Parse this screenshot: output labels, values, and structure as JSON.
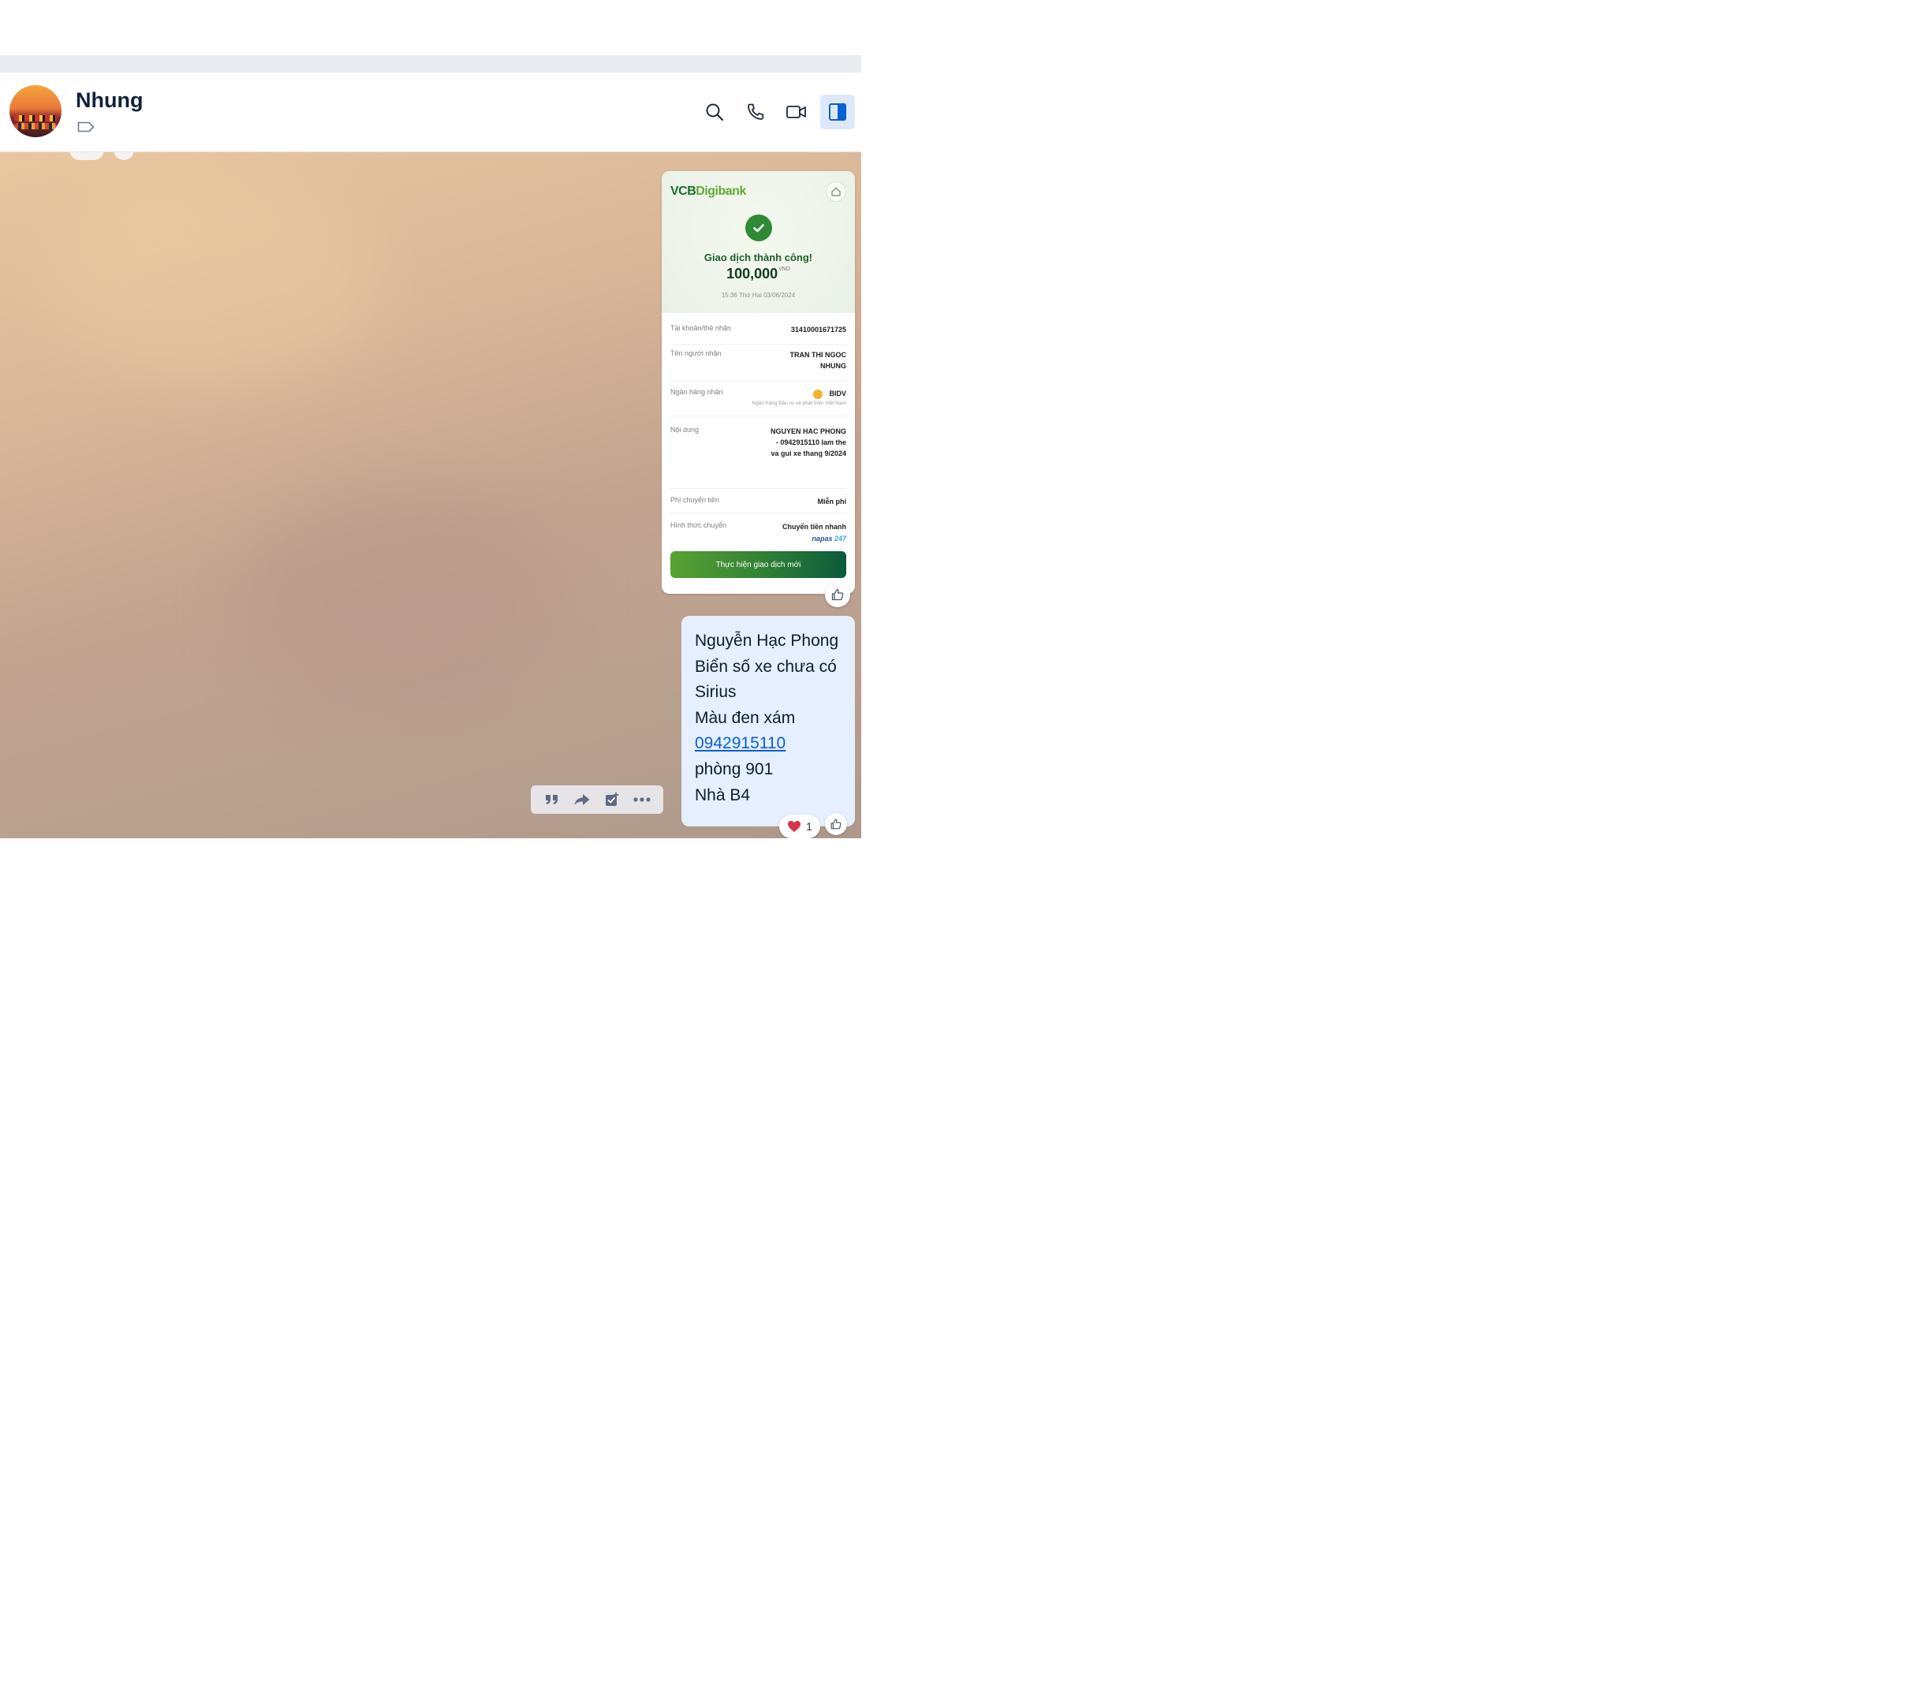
{
  "header": {
    "contact_name": "Nhung"
  },
  "icons": {
    "search": "search-icon",
    "call": "phone-icon",
    "video": "video-camera-icon",
    "panel": "side-panel-icon",
    "tag": "tag-icon",
    "like": "thumbs-up-icon",
    "quote": "quote-icon",
    "forward": "forward-icon",
    "task": "task-icon",
    "more": "more-icon",
    "home": "home-icon",
    "heart": "heart-icon"
  },
  "colors": {
    "accent": "#0a5fd1",
    "bubble_self": "#e5efff",
    "vcb_green": "#1a6d2d"
  },
  "receipt": {
    "brand_vcb": "VCB",
    "brand_digi": "Digibank",
    "status": "Giao dịch thành công!",
    "amount": "100,000",
    "currency": "VND",
    "datetime": "15:36 Thứ Hai 03/06/2024",
    "rows": [
      {
        "label": "Tài khoản/thẻ nhận",
        "value": "31410001671725"
      },
      {
        "label": "Tên người nhận",
        "value": "TRAN THI NGOC NHUNG"
      },
      {
        "label": "Ngân hàng nhận",
        "value": "BIDV",
        "sub": "Ngân hàng Đầu tư và phát triển Việt Nam"
      },
      {
        "label": "Nội dung",
        "value": "NGUYEN HAC PHONG - 0942915110 lam the va gui xe thang 9/2024"
      },
      {
        "label": "Phí chuyển tiền",
        "value": "Miễn phí"
      },
      {
        "label": "Hình thức chuyển",
        "value": "Chuyển tiền nhanh",
        "network_a": "napas",
        "network_b": "247"
      }
    ],
    "button": "Thực hiện giao dịch mới"
  },
  "message": {
    "lines": [
      "Nguyễn Hạc Phong",
      "Biển số xe chưa có",
      "Sirius",
      "Màu đen xám"
    ],
    "phone": "0942915110",
    "lines_after": [
      "phòng 901",
      "Nhà B4"
    ]
  },
  "reaction": {
    "count": "1"
  }
}
